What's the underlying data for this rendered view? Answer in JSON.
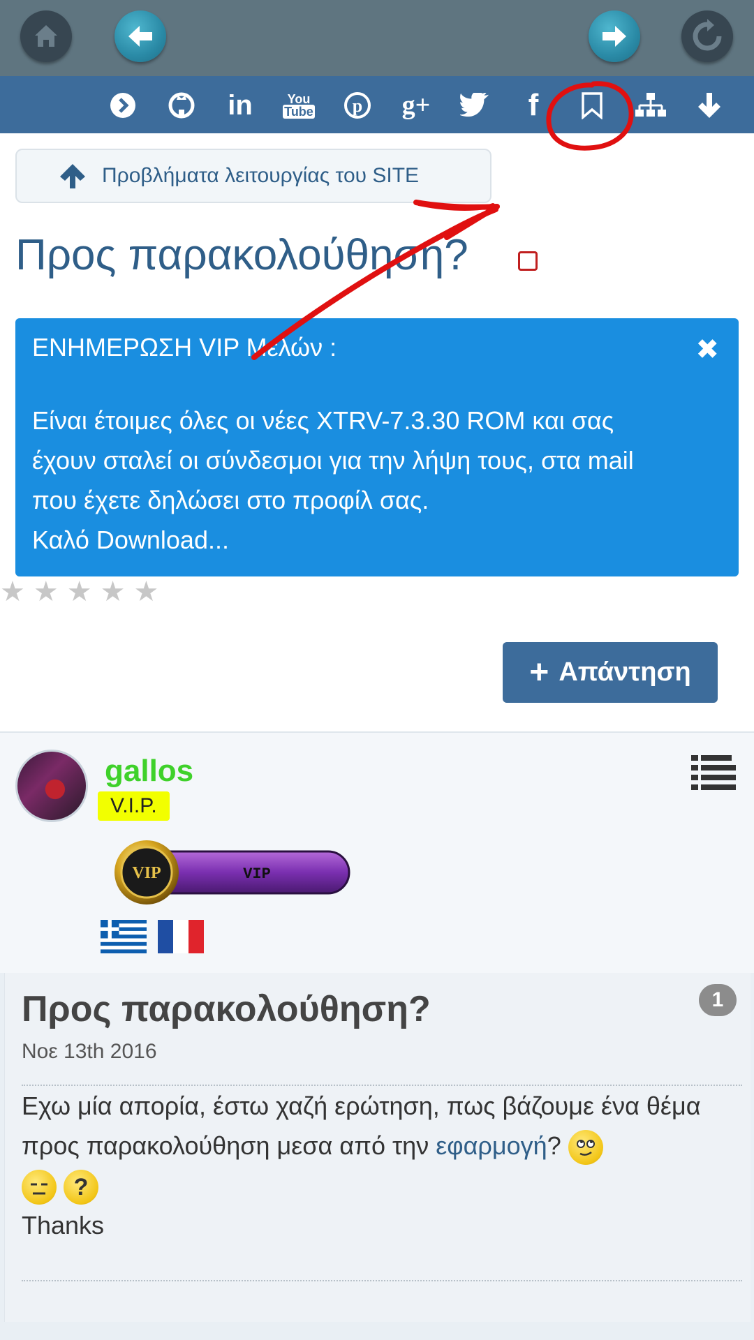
{
  "colors": {
    "topbar": "#5f7580",
    "iconbar": "#3d6c9b",
    "accent_blue": "#2f5e88",
    "notice_bg": "#1a8ee0",
    "username_green": "#3fd12a",
    "role_yellow": "#f2ff00",
    "annotation_red": "#e01010"
  },
  "topbar": {
    "buttons": [
      {
        "name": "home",
        "icon": "home-icon"
      },
      {
        "name": "back",
        "icon": "arrow-left-icon"
      },
      {
        "name": "forward",
        "icon": "arrow-right-icon"
      },
      {
        "name": "refresh",
        "icon": "refresh-icon"
      }
    ]
  },
  "iconbar": {
    "icons": [
      "chevron-right-circle-icon",
      "github-icon",
      "linkedin-icon",
      "youtube-icon",
      "pinterest-icon",
      "google-plus-icon",
      "twitter-icon",
      "facebook-icon",
      "bookmark-icon",
      "sitemap-icon",
      "arrow-down-icon"
    ],
    "linkedin_text": "in",
    "youtube_text": "You\nTube",
    "gplus_text": "g+",
    "facebook_text": "f"
  },
  "breadcrumb": {
    "label": "Προβλήματα λειτουργίας του SITE"
  },
  "page": {
    "title": "Προς παρακολούθηση?"
  },
  "notice": {
    "heading": "ΕΝΗΜΕΡΩΣΗ VIP Μελών :",
    "close": "✖",
    "lines": [
      "Είναι έτοιμες όλες οι νέες XTRV-7.3.30 ROM και σας",
      "έχουν σταλεί οι σύνδεσμοι για την λήψη τους, στα mail",
      "που έχετε δηλώσει στο προφίλ σας.",
      "Καλό Download..."
    ]
  },
  "rating": {
    "stars_total": 5,
    "stars_filled": 0
  },
  "reply_button": {
    "label": "Απάντηση"
  },
  "author": {
    "username": "gallos",
    "role": "V.I.P.",
    "badge_text": "VIP",
    "badge_seal": "VIP",
    "flags": [
      "greece-flag",
      "france-flag"
    ]
  },
  "post": {
    "title": "Προς παρακολούθηση?",
    "date": "Νοε 13th 2016",
    "number": "1",
    "body_before_link": "Εχω μία απορία, έστω χαζή ερώτηση, πως βάζουμε ένα θέμα προς παρακολούθηση μεσα από την ",
    "link": "εφαρμογή",
    "body_after_link": "?",
    "question_mark": "?",
    "thanks": "Thanks"
  }
}
